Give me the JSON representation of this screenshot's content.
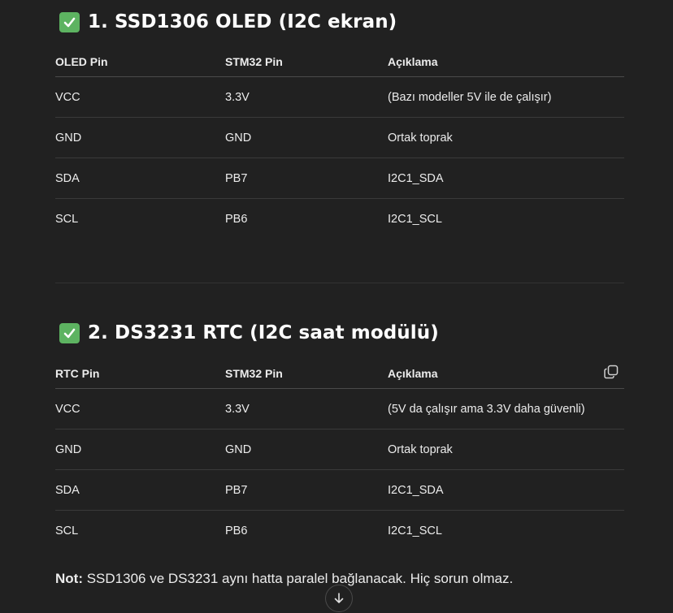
{
  "section1": {
    "title": "1. SSD1306 OLED (I2C ekran)",
    "icon": "check-mark-icon",
    "table": {
      "headers": [
        "OLED Pin",
        "STM32 Pin",
        "Açıklama"
      ],
      "rows": [
        [
          "VCC",
          "3.3V",
          "(Bazı modeller 5V ile de çalışır)"
        ],
        [
          "GND",
          "GND",
          "Ortak toprak"
        ],
        [
          "SDA",
          "PB7",
          "I2C1_SDA"
        ],
        [
          "SCL",
          "PB6",
          "I2C1_SCL"
        ]
      ]
    }
  },
  "section2": {
    "title": "2. DS3231 RTC (I2C saat modülü)",
    "icon": "check-mark-icon",
    "table": {
      "headers": [
        "RTC Pin",
        "STM32 Pin",
        "Açıklama"
      ],
      "rows": [
        [
          "VCC",
          "3.3V",
          "(5V da çalışır ama 3.3V daha güvenli)"
        ],
        [
          "GND",
          "GND",
          "Ortak toprak"
        ],
        [
          "SDA",
          "PB7",
          "I2C1_SDA"
        ],
        [
          "SCL",
          "PB6",
          "I2C1_SCL"
        ]
      ]
    }
  },
  "note": {
    "label": "Not:",
    "text": " SSD1306 ve DS3231 aynı hatta paralel bağlanacak. Hiç sorun olmaz."
  },
  "colors": {
    "background": "#212121",
    "check_icon": "#5db361",
    "text": "#ececec"
  }
}
